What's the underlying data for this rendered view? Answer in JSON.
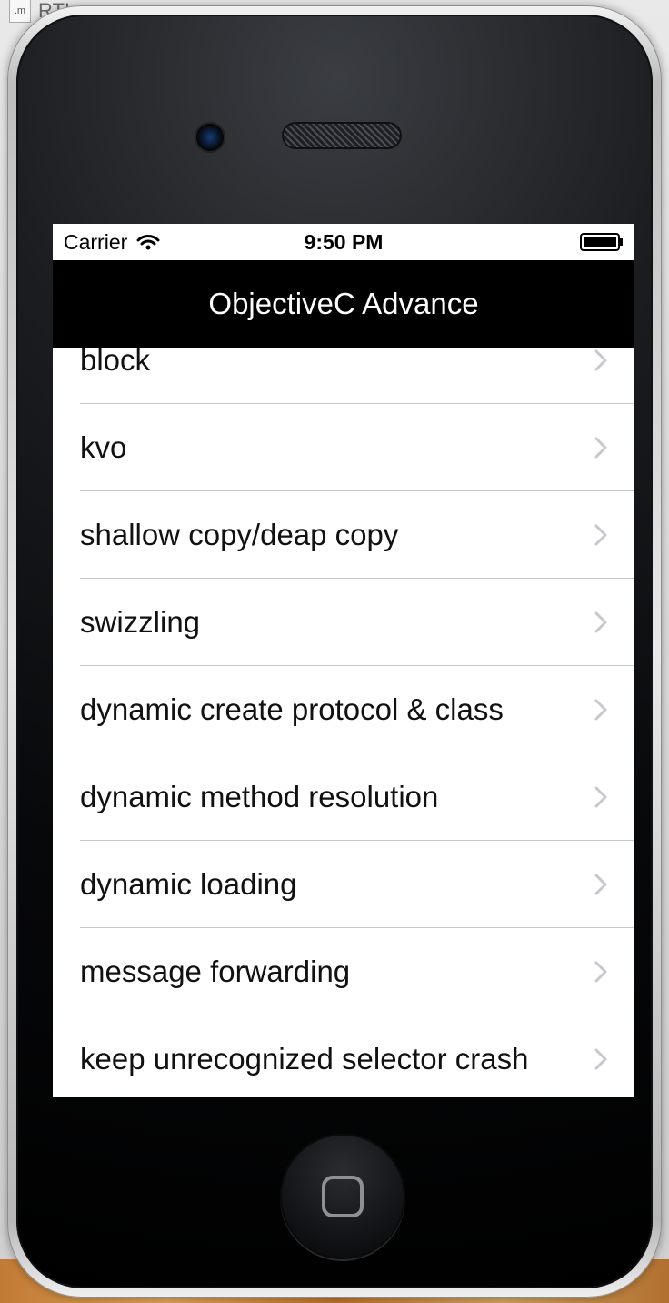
{
  "desktop": {
    "file_ext": ".m",
    "file_name": "RTI..."
  },
  "status_bar": {
    "carrier": "Carrier",
    "time": "9:50 PM"
  },
  "nav": {
    "title": "ObjectiveC Advance"
  },
  "table": {
    "rows": [
      {
        "label": "block"
      },
      {
        "label": "kvo"
      },
      {
        "label": "shallow copy/deap copy"
      },
      {
        "label": "swizzling"
      },
      {
        "label": "dynamic create protocol & class"
      },
      {
        "label": "dynamic method resolution"
      },
      {
        "label": "dynamic loading"
      },
      {
        "label": "message forwarding"
      },
      {
        "label": "keep unrecognized selector crash"
      }
    ]
  },
  "colors": {
    "nav_background": "#000000",
    "nav_text": "#ffffff",
    "separator": "#c8c7cc",
    "chevron": "#c7c7cc"
  },
  "icons": {
    "wifi": "wifi-icon",
    "battery": "battery-icon",
    "chevron": "chevron-right-icon",
    "home": "home-button-square-icon"
  }
}
